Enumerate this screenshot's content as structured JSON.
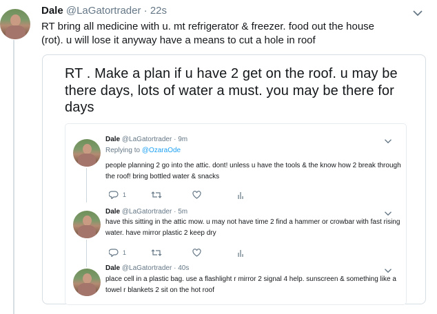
{
  "outer_tweet": {
    "name": "Dale",
    "handle": "@LaGatortrader",
    "time": "22s",
    "text": "RT bring all medicine with u. mt refrigerator & freezer. food out the house (rot). u will lose it anyway have a means to cut a hole in roof"
  },
  "quoted_tweet": {
    "text": "RT . Make a plan if u have 2 get on the roof. u may be there days, lots of water a must. you may be there for days"
  },
  "thread": [
    {
      "name": "Dale",
      "handle": "@LaGatortrader",
      "time": "9m",
      "replying_label": "Replying to",
      "replying_handle": "@OzaraOde",
      "text": "people planning 2 go into the attic. dont! unless u have the tools & the know how 2 break through the roof! bring bottled water & snacks",
      "reply_count": "1"
    },
    {
      "name": "Dale",
      "handle": "@LaGatortrader",
      "time": "5m",
      "text": "have this sitting in the attic mow. u may not have time 2 find a hammer or crowbar with fast rising water. have mirror plastic 2 keep dry",
      "reply_count": "1"
    },
    {
      "name": "Dale",
      "handle": "@LaGatortrader",
      "time": "40s",
      "text": "place cell in a plastic bag. use a flashlight r mirror 2 signal 4 help. sunscreen & something like a towel r blankets 2 sit on the hot roof"
    }
  ],
  "icons": [
    "chevron-down-icon",
    "reply-icon",
    "retweet-icon",
    "like-icon",
    "analytics-icon"
  ],
  "colors": {
    "text": "#14171a",
    "muted": "#657786",
    "link": "#1da1f2",
    "border": "#e6ecf0"
  }
}
